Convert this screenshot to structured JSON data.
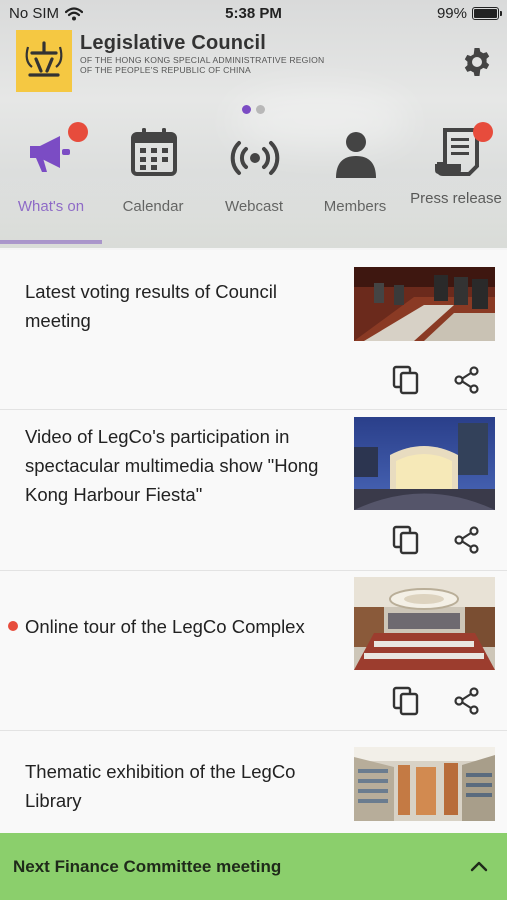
{
  "status": {
    "carrier": "No SIM",
    "time": "5:38 PM",
    "battery": "99%",
    "battery_level": 0.99
  },
  "header": {
    "title": "Legislative Council",
    "subtitle_line1": "OF THE HONG KONG SPECIAL ADMINISTRATIVE REGION",
    "subtitle_line2": "OF THE PEOPLE'S REPUBLIC OF CHINA",
    "logo_glyph": "立",
    "logo_icon": "legco-logo",
    "settings_icon": "gear-icon"
  },
  "pager": {
    "pages": 2,
    "current": 1
  },
  "tabs": [
    {
      "label": "What's on",
      "icon": "megaphone-icon",
      "active": true,
      "badge": true
    },
    {
      "label": "Calendar",
      "icon": "calendar-icon",
      "active": false,
      "badge": false
    },
    {
      "label": "Webcast",
      "icon": "broadcast-icon",
      "active": false,
      "badge": false
    },
    {
      "label": "Members",
      "icon": "person-icon",
      "active": false,
      "badge": false
    },
    {
      "label": "Press release",
      "icon": "scroll-document-icon",
      "active": false,
      "badge": true
    }
  ],
  "items": [
    {
      "title": "Latest voting results of Council meeting",
      "unread": false,
      "thumbnail": "council-chamber-seats"
    },
    {
      "title": "Video of LegCo's participation in spectacular multimedia show \"Hong Kong Harbour Fiesta\"",
      "unread": false,
      "thumbnail": "legco-building-night"
    },
    {
      "title": "Online tour of the LegCo Complex",
      "unread": true,
      "thumbnail": "council-chamber-interior"
    },
    {
      "title": "Thematic exhibition of the LegCo Library",
      "unread": false,
      "thumbnail": "library-shelves"
    }
  ],
  "bottom_bar": {
    "label": "Next Finance Committee meeting",
    "icon": "chevron-up-icon"
  },
  "colors": {
    "accent": "#7b4cc4",
    "badge": "#e74c3c",
    "bottom_bar": "#8bcf6c",
    "logo": "#f5c842"
  }
}
